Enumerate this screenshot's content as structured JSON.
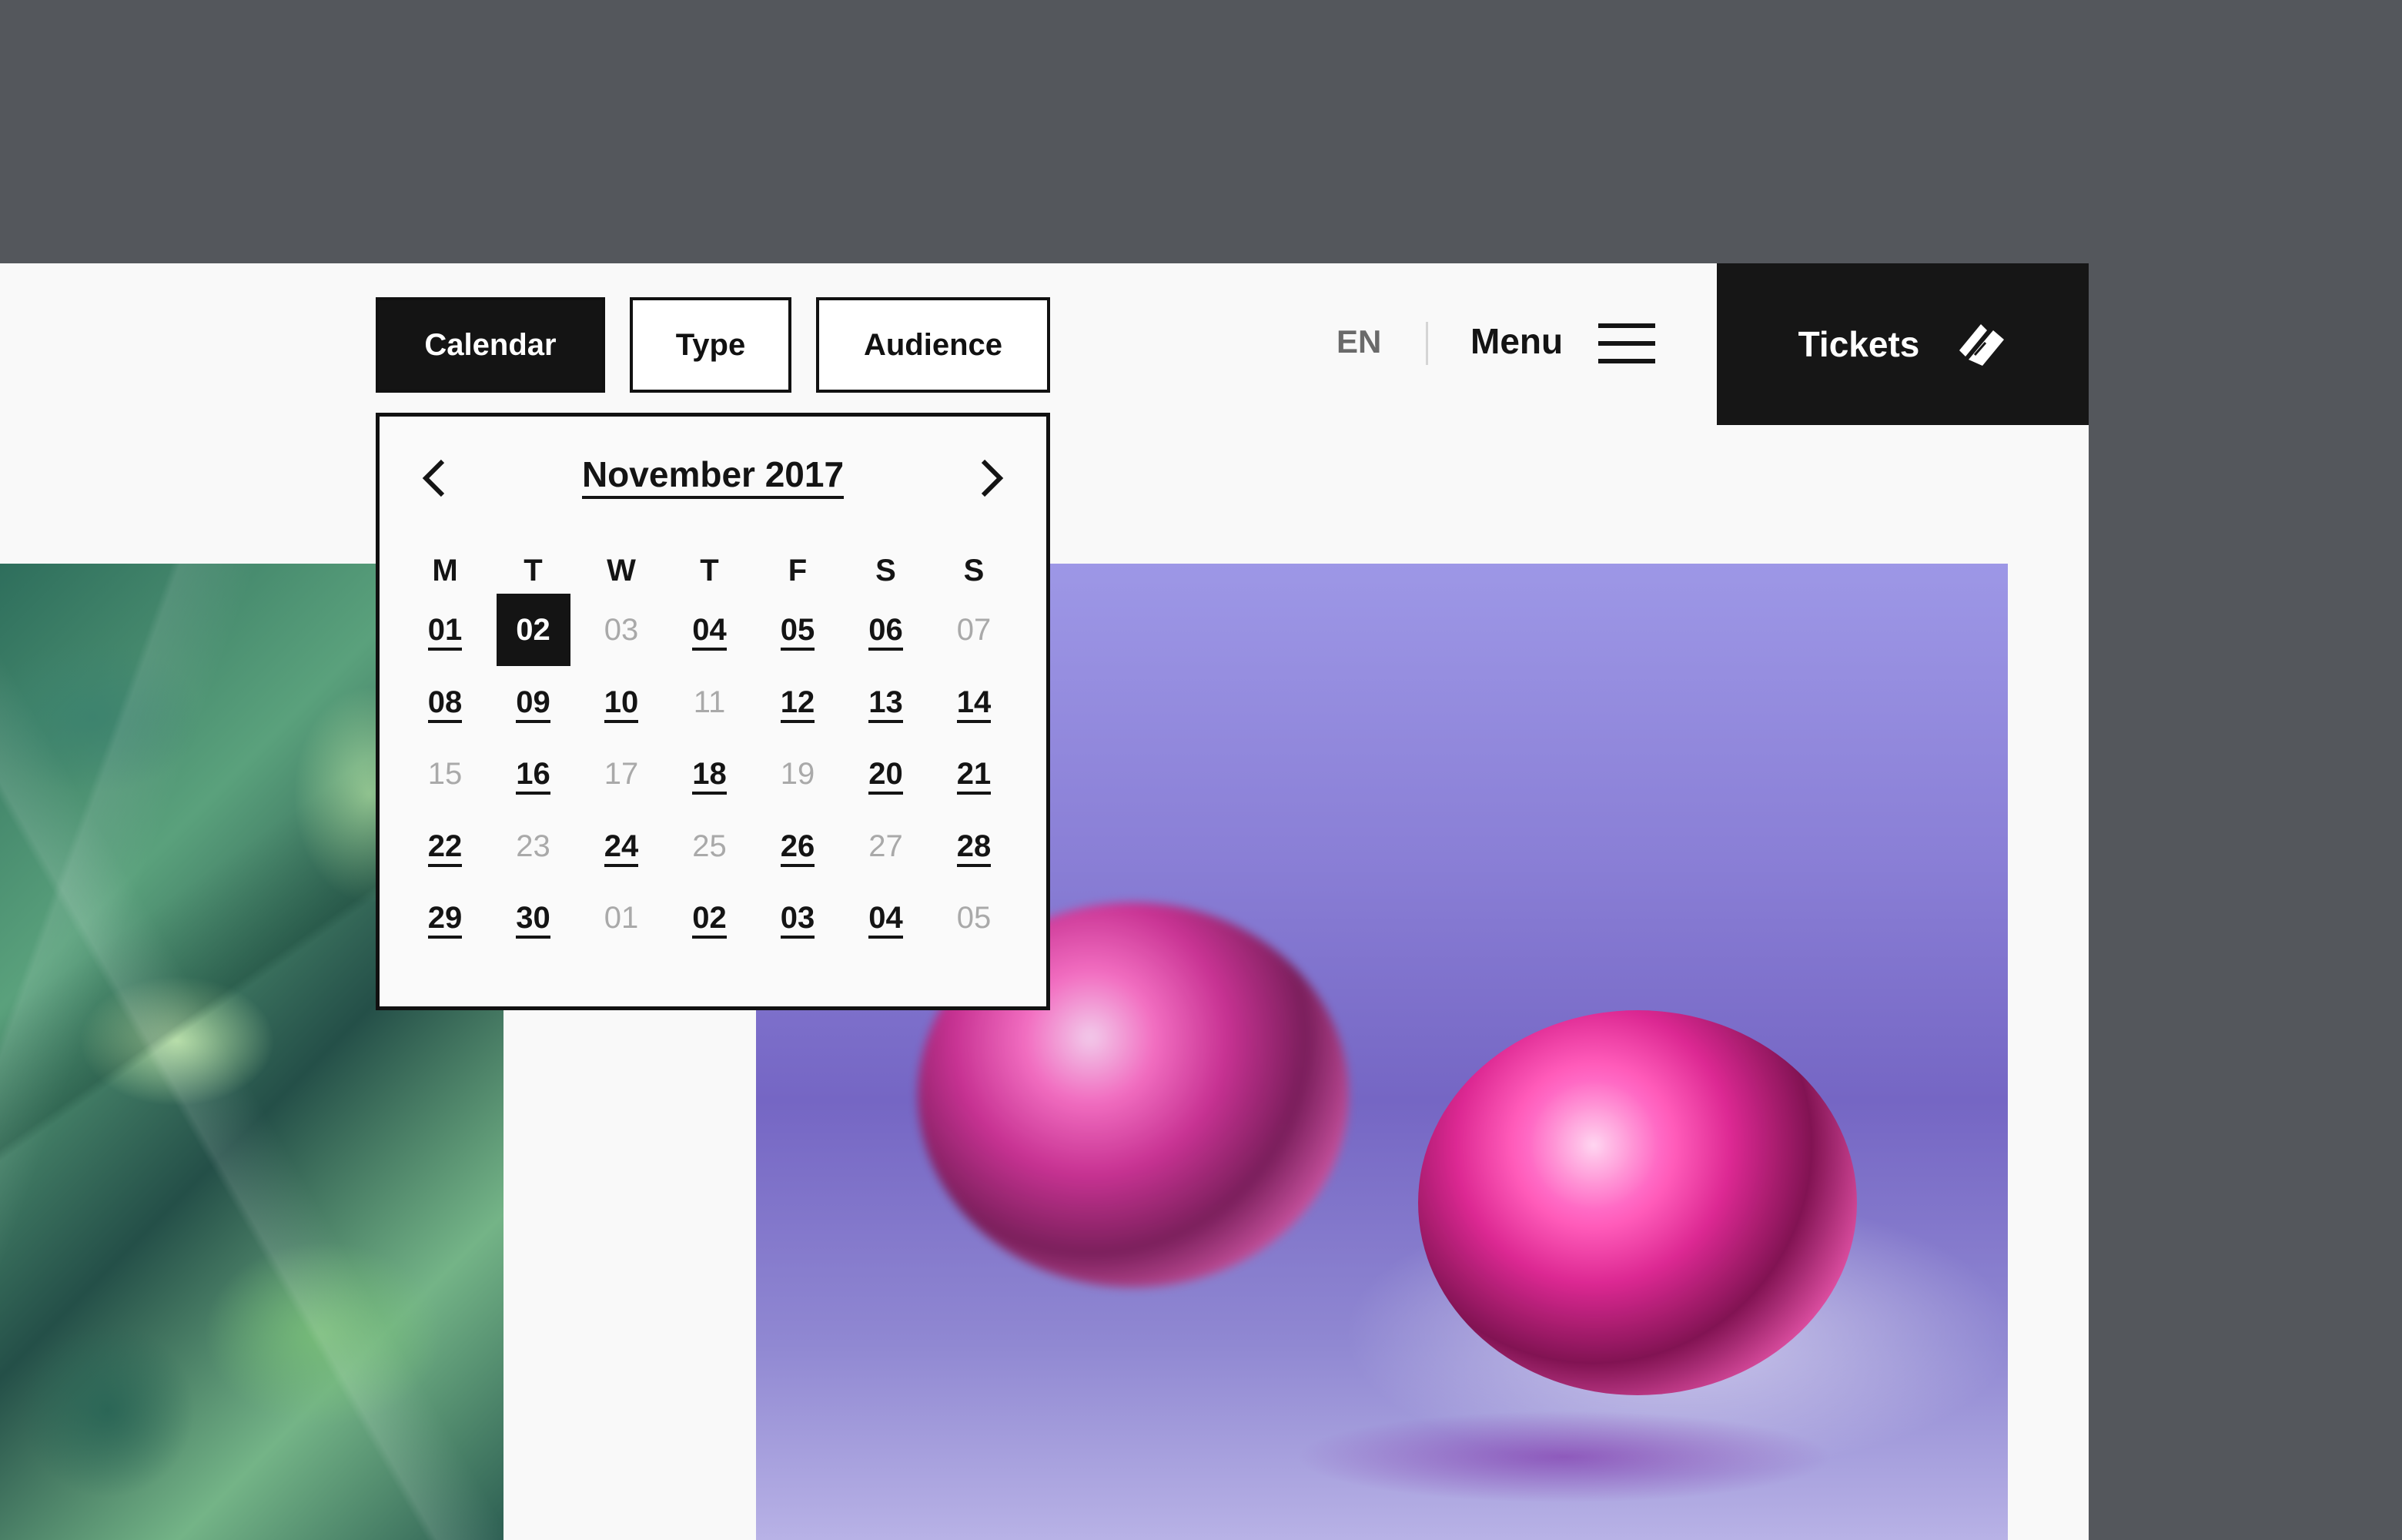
{
  "filters": {
    "calendar_label": "Calendar",
    "type_label": "Type",
    "audience_label": "Audience"
  },
  "header": {
    "language": "EN",
    "menu_label": "Menu",
    "tickets_label": "Tickets"
  },
  "calendar": {
    "month_label": "November 2017",
    "weekdays": [
      "M",
      "T",
      "W",
      "T",
      "F",
      "S",
      "S"
    ],
    "weeks": [
      [
        {
          "d": "01",
          "s": "avail"
        },
        {
          "d": "02",
          "s": "selected"
        },
        {
          "d": "03",
          "s": "muted"
        },
        {
          "d": "04",
          "s": "avail"
        },
        {
          "d": "05",
          "s": "avail"
        },
        {
          "d": "06",
          "s": "avail"
        },
        {
          "d": "07",
          "s": "muted"
        }
      ],
      [
        {
          "d": "08",
          "s": "avail"
        },
        {
          "d": "09",
          "s": "avail"
        },
        {
          "d": "10",
          "s": "avail"
        },
        {
          "d": "11",
          "s": "muted"
        },
        {
          "d": "12",
          "s": "avail"
        },
        {
          "d": "13",
          "s": "avail"
        },
        {
          "d": "14",
          "s": "avail"
        }
      ],
      [
        {
          "d": "15",
          "s": "muted"
        },
        {
          "d": "16",
          "s": "avail"
        },
        {
          "d": "17",
          "s": "muted"
        },
        {
          "d": "18",
          "s": "avail"
        },
        {
          "d": "19",
          "s": "muted"
        },
        {
          "d": "20",
          "s": "avail"
        },
        {
          "d": "21",
          "s": "avail"
        }
      ],
      [
        {
          "d": "22",
          "s": "avail"
        },
        {
          "d": "23",
          "s": "muted"
        },
        {
          "d": "24",
          "s": "avail"
        },
        {
          "d": "25",
          "s": "muted"
        },
        {
          "d": "26",
          "s": "avail"
        },
        {
          "d": "27",
          "s": "muted"
        },
        {
          "d": "28",
          "s": "avail"
        }
      ],
      [
        {
          "d": "29",
          "s": "avail"
        },
        {
          "d": "30",
          "s": "avail"
        },
        {
          "d": "01",
          "s": "muted"
        },
        {
          "d": "02",
          "s": "avail"
        },
        {
          "d": "03",
          "s": "avail"
        },
        {
          "d": "04",
          "s": "avail"
        },
        {
          "d": "05",
          "s": "muted"
        }
      ]
    ]
  },
  "colors": {
    "backdrop": "#54575c",
    "page": "#f9f9f9",
    "ink": "#141414",
    "muted_day": "#a9a9a9"
  },
  "icons": {
    "prev": "chevron-left-icon",
    "next": "chevron-right-icon",
    "menu": "hamburger-icon",
    "tickets": "ticket-icon"
  }
}
